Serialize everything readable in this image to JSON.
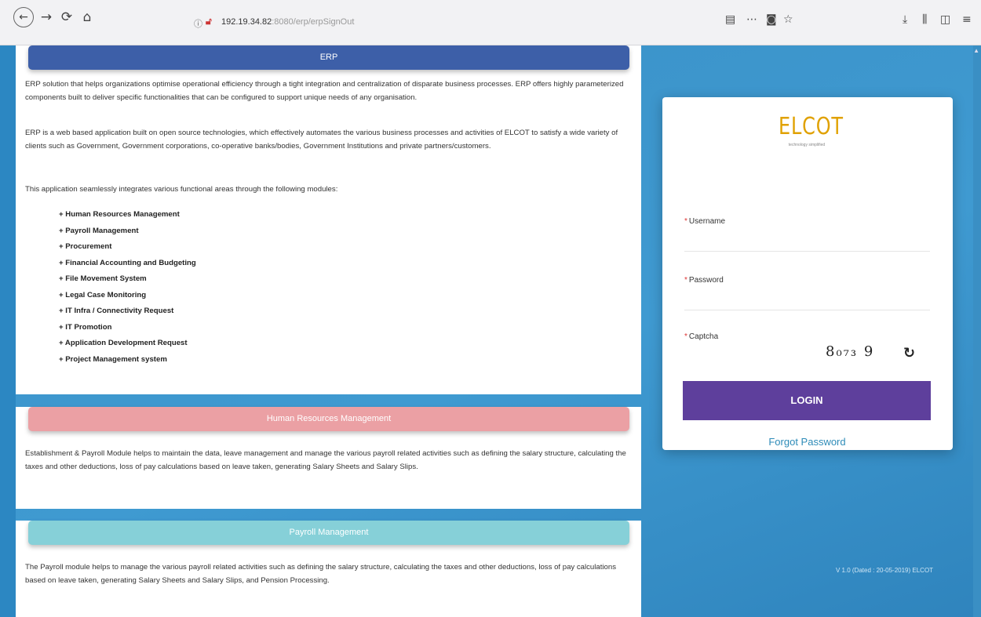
{
  "browser": {
    "url_host": "192.19.34.82",
    "url_path": ":8080/erp/erpSignOut"
  },
  "erp": {
    "title": "ERP",
    "para1": "ERP solution that helps organizations optimise operational efficiency through a tight integration and centralization of disparate business processes. ERP offers highly parameterized components built to deliver specific functionalities that can be configured to support unique needs of any organisation.",
    "para2": "ERP is a web based application built on open source technologies, which effectively automates the various business processes and activities of ELCOT to satisfy a wide variety of clients such as Government, Government corporations, co-operative banks/bodies, Government Institutions and private partners/customers.",
    "para3": "This application seamlessly integrates various functional areas through the following modules:",
    "modules": [
      "Human Resources Management",
      "Payroll Management",
      "Procurement",
      "Financial Accounting and Budgeting",
      "File Movement System",
      "Legal Case Monitoring",
      "IT Infra / Connectivity Request",
      "IT Promotion",
      "Application Development Request",
      "Project Management system"
    ]
  },
  "hrm": {
    "title": "Human Resources Management",
    "para": "Establishment & Payroll Module helps to maintain the data, leave management and manage the various payroll related activities such as defining the salary structure, calculating the taxes and other deductions, loss of pay calculations based on leave taken, generating Salary Sheets and Salary Slips."
  },
  "payroll": {
    "title": "Payroll Management",
    "para": "The Payroll module helps to manage the various payroll related activities such as defining the salary structure, calculating the taxes and other deductions, loss of pay calculations based on leave taken, generating Salary Sheets and Salary Slips, and Pension Processing."
  },
  "login": {
    "logo_text": "ELCOT",
    "tagline": "technology simplified",
    "username_label": "Username",
    "password_label": "Password",
    "captcha_label": "Captcha",
    "captcha_value": "8₀₇₃ 9",
    "login_button": "LOGIN",
    "forgot_link": "Forgot Password"
  },
  "version": "V 1.0 (Dated : 20-05-2019) ELCOT"
}
